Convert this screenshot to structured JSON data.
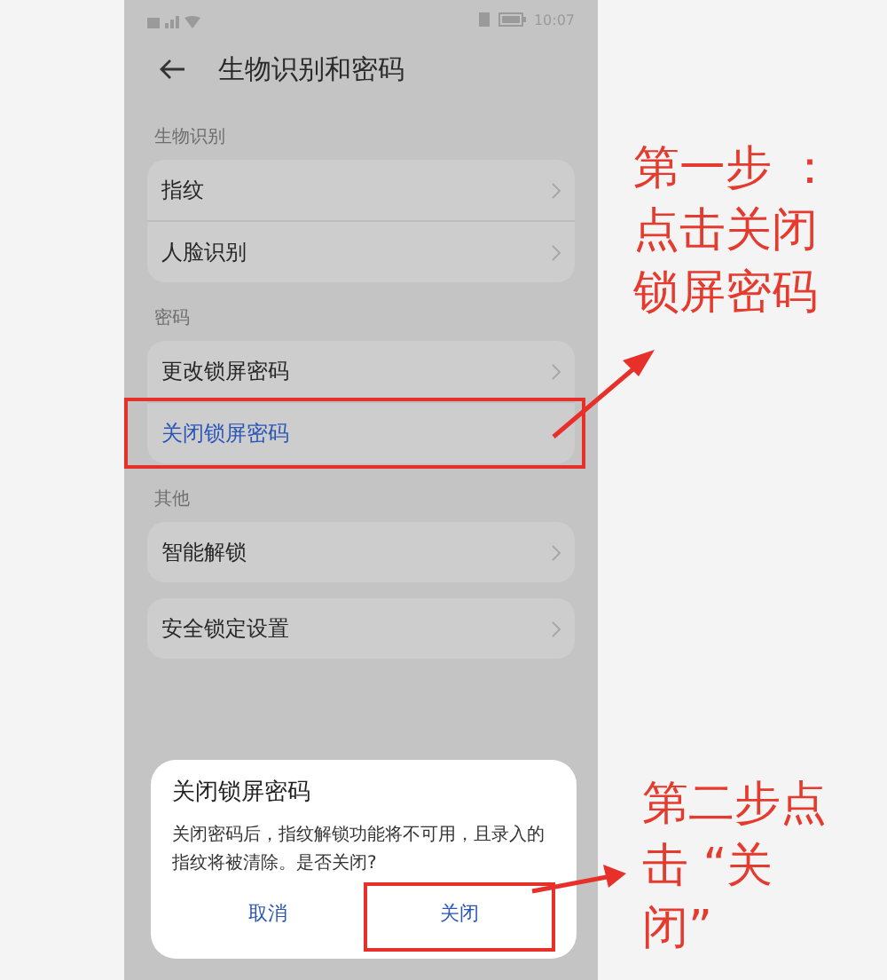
{
  "status_bar": {
    "time": "10:07"
  },
  "header": {
    "title": "生物识别和密码"
  },
  "sections": [
    {
      "label": "生物识别",
      "cards": [
        [
          {
            "label": "指纹",
            "kind": "nav",
            "marked": false
          },
          {
            "label": "人脸识别",
            "kind": "nav",
            "marked": false
          }
        ]
      ]
    },
    {
      "label": "密码",
      "cards": [
        [
          {
            "label": "更改锁屏密码",
            "kind": "nav",
            "marked": false
          },
          {
            "label": "关闭锁屏密码",
            "kind": "action",
            "marked": true
          }
        ]
      ]
    },
    {
      "label": "其他",
      "cards": [
        [
          {
            "label": "智能解锁",
            "kind": "nav",
            "marked": false
          }
        ],
        [
          {
            "label": "安全锁定设置",
            "kind": "nav",
            "marked": false
          }
        ]
      ]
    }
  ],
  "dialog": {
    "title": "关闭锁屏密码",
    "message": "关闭密码后，指纹解锁功能将不可用，且录入的指纹将被清除。是否关闭?",
    "buttons": [
      {
        "label": "取消",
        "marked": false
      },
      {
        "label": "关闭",
        "marked": true
      }
    ]
  },
  "annotations": [
    {
      "lines": [
        "第一步 ：",
        "点击关闭",
        "锁屏密码"
      ]
    },
    {
      "lines": [
        "第二步点",
        "击 “关",
        "闭”"
      ]
    }
  ]
}
